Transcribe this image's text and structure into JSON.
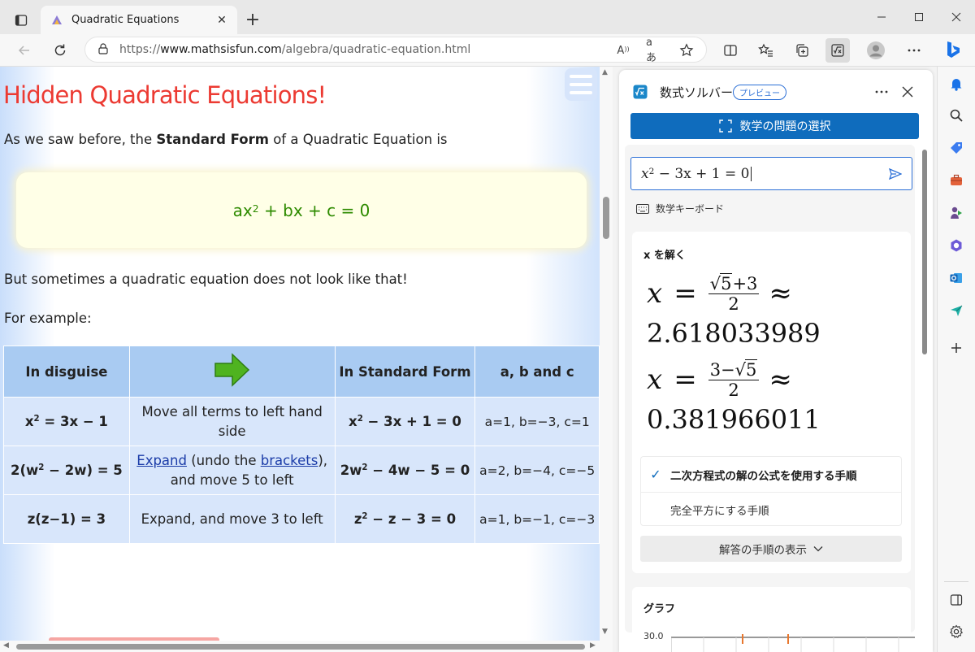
{
  "browser": {
    "tab_title": "Quadratic Equations",
    "url_prefix": "https://",
    "url_host": "www.mathsisfun.com",
    "url_path": "/algebra/quadratic-equation.html",
    "read_aloud_glyph": "A",
    "translate_glyph": "aあ",
    "accent_color": "#0f6cbd"
  },
  "page": {
    "heading": "Hidden Quadratic Equations!",
    "intro_before": "As we saw before, the ",
    "intro_bold": "Standard Form",
    "intro_after": " of a Quadratic Equation is",
    "formula": {
      "a": "ax",
      "exp": "2",
      "rest": " + bx + c = 0"
    },
    "sometimes_text": "But sometimes a quadratic equation does not look like that!",
    "example_text": "For example:",
    "table": {
      "headers": [
        "In disguise",
        "In Standard Form",
        "a, b and c"
      ],
      "rows": [
        {
          "disguise_a": "x",
          "disguise_exp": "2",
          "disguise_b": " = 3x − 1",
          "action": "Move all terms to left hand side",
          "std_a": "x",
          "std_exp": "2",
          "std_b": " − 3x + 1 = 0",
          "abc": "a=1, b=−3, c=1"
        },
        {
          "disguise_a": "2(w",
          "disguise_exp": "2",
          "disguise_b": " − 2w) = 5",
          "action_link1": "Expand",
          "action_mid": " (undo the ",
          "action_link2": "brackets",
          "action_end": "), and move 5 to left",
          "std_a": "2w",
          "std_exp": "2",
          "std_b": " − 4w − 5 = 0",
          "abc": "a=2, b=−4, c=−5"
        },
        {
          "disguise": "z(z−1) = 3",
          "action": "Expand, and move 3 to left",
          "std_a": "z",
          "std_exp": "2",
          "std_b": " − z − 3 = 0",
          "abc": "a=1, b=−1, c=−3"
        }
      ]
    }
  },
  "solver": {
    "title": "数式ソルバー",
    "badge": "プレビュー",
    "select_button": "数学の問題の選択",
    "input": {
      "a": "x",
      "exp": "2",
      "rest": " − 3x + 1 = 0"
    },
    "keyboard_link": "数学キーボード",
    "solve_heading": "x を解く",
    "root1": {
      "var": "x",
      "eq": "=",
      "rad": "5",
      "num_tail": "+3",
      "den": "2",
      "approx": "≈",
      "decimal": "2.618033989"
    },
    "root2": {
      "var": "x",
      "eq": "=",
      "num_head": "3−",
      "rad": "5",
      "den": "2",
      "approx": "≈",
      "decimal": "0.381966011"
    },
    "methods": [
      "二次方程式の解の公式を使用する手順",
      "完全平方にする手順"
    ],
    "steps_button": "解答の手順の表示",
    "graph_title": "グラフ",
    "graph_y_label": "30.0"
  }
}
